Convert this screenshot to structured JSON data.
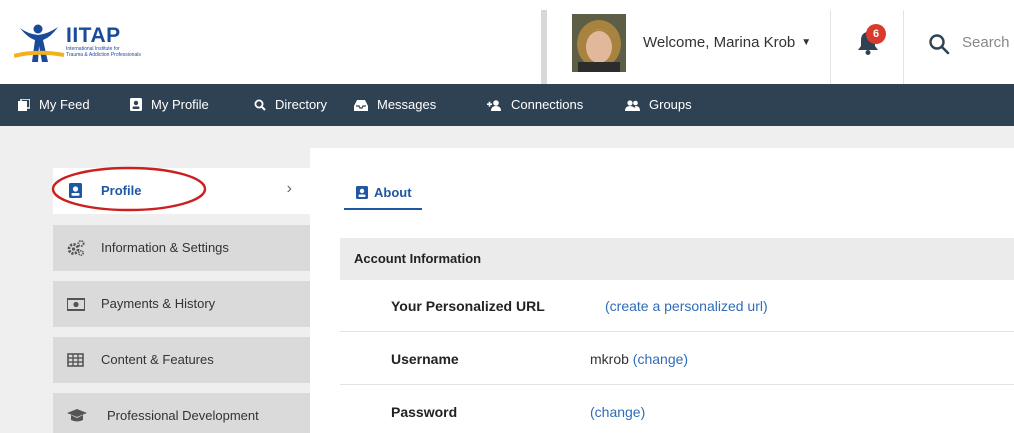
{
  "brand": {
    "name": "IITAP",
    "tagline_line1": "International Institute for",
    "tagline_line2": "Trauma & Addiction Professionals"
  },
  "header": {
    "welcome": "Welcome, Marina Krob",
    "notifications_count": "6",
    "search_placeholder": "Search"
  },
  "nav": {
    "items": [
      {
        "label": "My Feed",
        "icon": "feed-icon"
      },
      {
        "label": "My Profile",
        "icon": "profile-card-icon"
      },
      {
        "label": "Directory",
        "icon": "search-icon"
      },
      {
        "label": "Messages",
        "icon": "inbox-icon"
      },
      {
        "label": "Connections",
        "icon": "user-plus-icon"
      },
      {
        "label": "Groups",
        "icon": "users-icon"
      }
    ]
  },
  "sidebar": {
    "items": [
      {
        "label": "Profile",
        "icon": "profile-card-icon",
        "active": true
      },
      {
        "label": "Information & Settings",
        "icon": "gears-icon"
      },
      {
        "label": "Payments & History",
        "icon": "money-icon"
      },
      {
        "label": "Content & Features",
        "icon": "grid-icon"
      },
      {
        "label": "Professional Development",
        "icon": "graduation-cap-icon"
      }
    ]
  },
  "main": {
    "tab_label": "About",
    "section_title": "Account Information",
    "rows": [
      {
        "label": "Your Personalized URL",
        "value_text": "",
        "link": "(create a personalized url)"
      },
      {
        "label": "Username",
        "value_text": "mkrob ",
        "link": "(change)"
      },
      {
        "label": "Password",
        "value_text": "",
        "link": "(change)"
      }
    ]
  },
  "colors": {
    "nav_bg": "#2f4254",
    "accent": "#1e57a3",
    "link": "#2f6db8",
    "badge": "#d93a2b",
    "annotation": "#cc1f1f"
  }
}
